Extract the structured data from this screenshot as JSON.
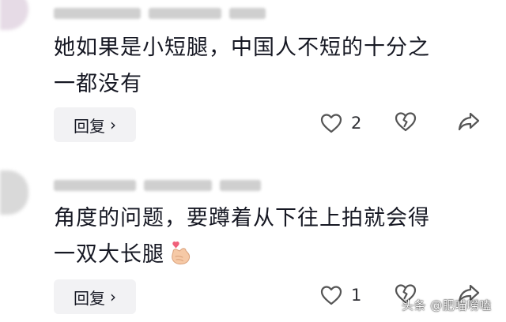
{
  "comments": [
    {
      "text_line1": "她如果是小短腿，中国人不短的十分之",
      "text_line2": "一都没有",
      "reply_label": "回复",
      "like_count": "2"
    },
    {
      "text_line1": "角度的问题，要蹲着从下往上拍就会得",
      "text_line2": "一双大长腿",
      "emoji": "finger-heart-emoji",
      "reply_label": "回复",
      "like_count": "1"
    }
  ],
  "watermark": "头条 @肥喵嘮嗑",
  "colors": {
    "text": "#161823",
    "reply_bg": "#f2f2f4",
    "icon": "#555555",
    "heart_emoji": "#f0607a",
    "hand_emoji": "#f6c9a6"
  }
}
